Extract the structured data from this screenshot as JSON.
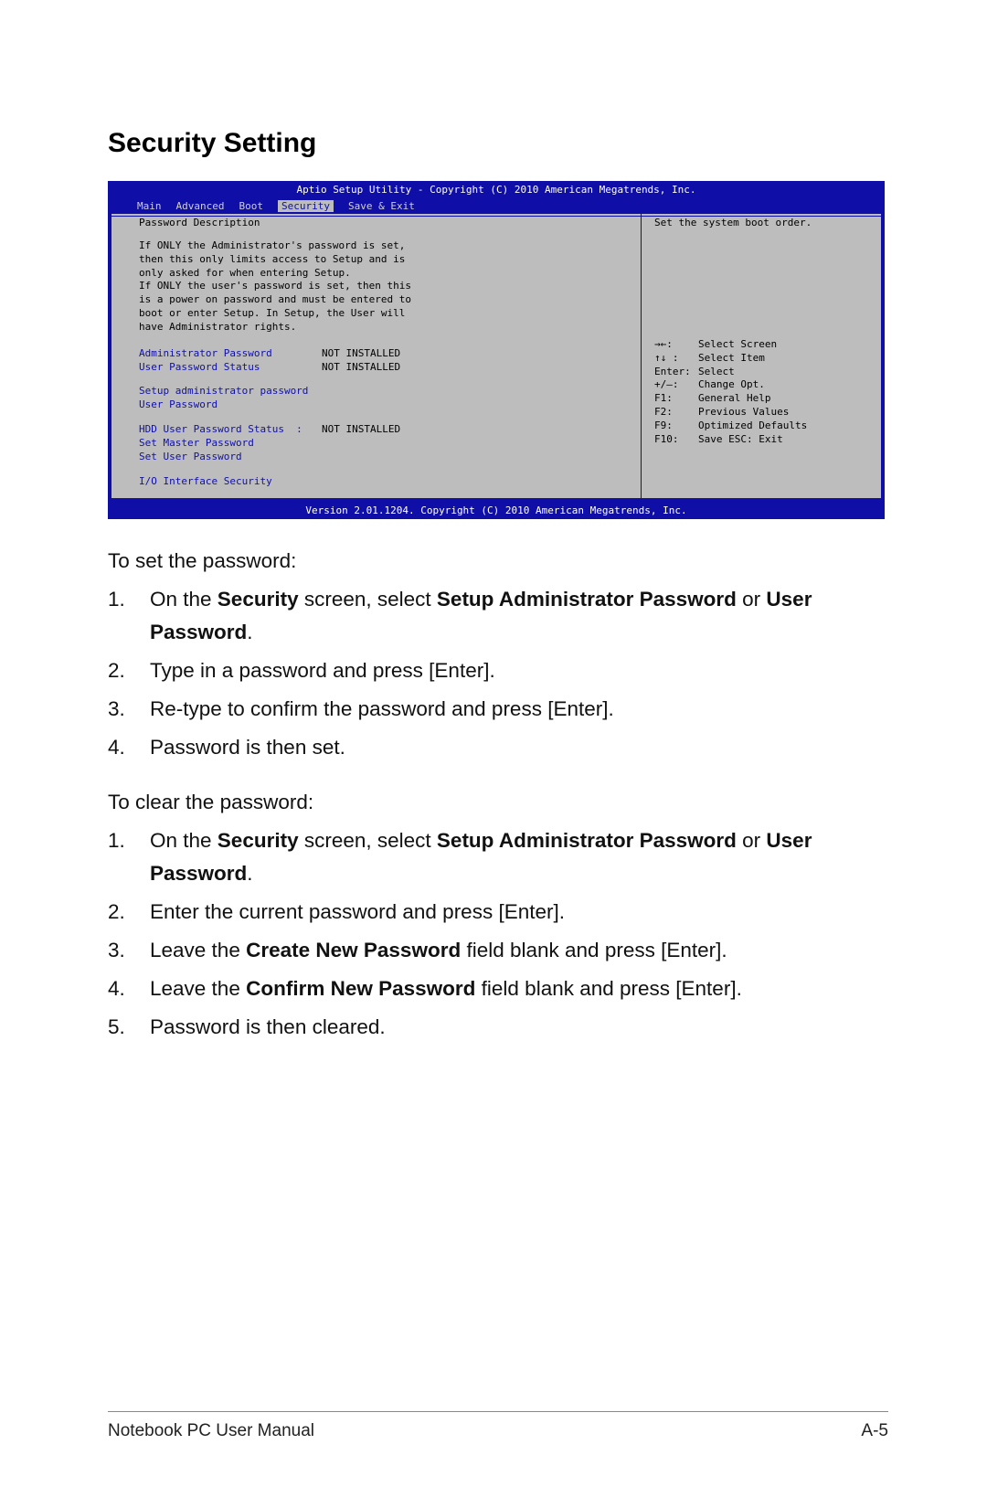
{
  "heading": "Security Setting",
  "bios": {
    "title_top": "Aptio Setup Utility - Copyright (C) 2010 American Megatrends, Inc.",
    "menus": [
      "Main",
      "Advanced",
      "Boot",
      "Security",
      "Save & Exit"
    ],
    "menu_selected_index": 3,
    "left": {
      "header": "Password Description",
      "desc_lines": [
        "If ONLY the Administrator's password is set,",
        "then this only limits access to Setup and is",
        "only asked for when entering Setup.",
        "If ONLY the user's password is set, then this",
        "is a power on password and must be entered to",
        "boot or enter Setup. In Setup, the User will",
        "have Administrator rights."
      ],
      "rows1": [
        {
          "label": "Administrator Password",
          "value": "NOT INSTALLED"
        },
        {
          "label": "User Password Status",
          "value": "NOT INSTALLED"
        }
      ],
      "rows2": [
        {
          "label": "Setup administrator password",
          "value": ""
        },
        {
          "label": "User Password",
          "value": ""
        }
      ],
      "rows3": [
        {
          "label": "HDD User Password Status  :",
          "value": "NOT INSTALLED"
        },
        {
          "label": "Set Master Password",
          "value": ""
        },
        {
          "label": "Set User Password",
          "value": ""
        }
      ],
      "io": "I/O Interface Security"
    },
    "right": {
      "help1": "Set the system boot order.",
      "help_keys": [
        {
          "k": "→←:",
          "d": "Select Screen"
        },
        {
          "k": "↑↓   :",
          "d": "Select Item"
        },
        {
          "k": "Enter:",
          "d": "Select"
        },
        {
          "k": "+/—:",
          "d": "Change Opt."
        },
        {
          "k": "F1:",
          "d": "General Help"
        },
        {
          "k": "F2:",
          "d": "Previous Values"
        },
        {
          "k": "F9:",
          "d": "Optimized Defaults"
        },
        {
          "k": "F10:",
          "d": "Save   ESC:  Exit"
        }
      ]
    },
    "footer": "Version 2.01.1204. Copyright (C) 2010 American Megatrends, Inc."
  },
  "set_intro": "To set the password:",
  "set_steps": [
    {
      "n": "1.",
      "pre": "On the ",
      "b1": "Security",
      "mid": " screen, select ",
      "b2": "Setup Administrator Password",
      "post": " or ",
      "b3": "User Password",
      "end": "."
    },
    {
      "n": "2.",
      "plain": "Type in a password and press [Enter]."
    },
    {
      "n": "3.",
      "plain": "Re-type to confirm the password and press [Enter]."
    },
    {
      "n": "4.",
      "plain": "Password is then set."
    }
  ],
  "clear_intro": "To clear the password:",
  "clear_steps": [
    {
      "n": "1.",
      "pre": "On the ",
      "b1": "Security",
      "mid": " screen, select ",
      "b2": "Setup Administrator Password",
      "post": " or ",
      "b3": "User Password",
      "end": "."
    },
    {
      "n": "2.",
      "plain": "Enter the current password and press [Enter]."
    },
    {
      "n": "3.",
      "pre": "Leave the ",
      "b1": "Create New Password",
      "end": " field blank and press [Enter]."
    },
    {
      "n": "4.",
      "pre": "Leave the ",
      "b1": "Confirm New Password",
      "end": " field blank and press [Enter]."
    },
    {
      "n": "5.",
      "plain": "Password is then cleared."
    }
  ],
  "footer_left": "Notebook PC User Manual",
  "footer_right": "A-5"
}
